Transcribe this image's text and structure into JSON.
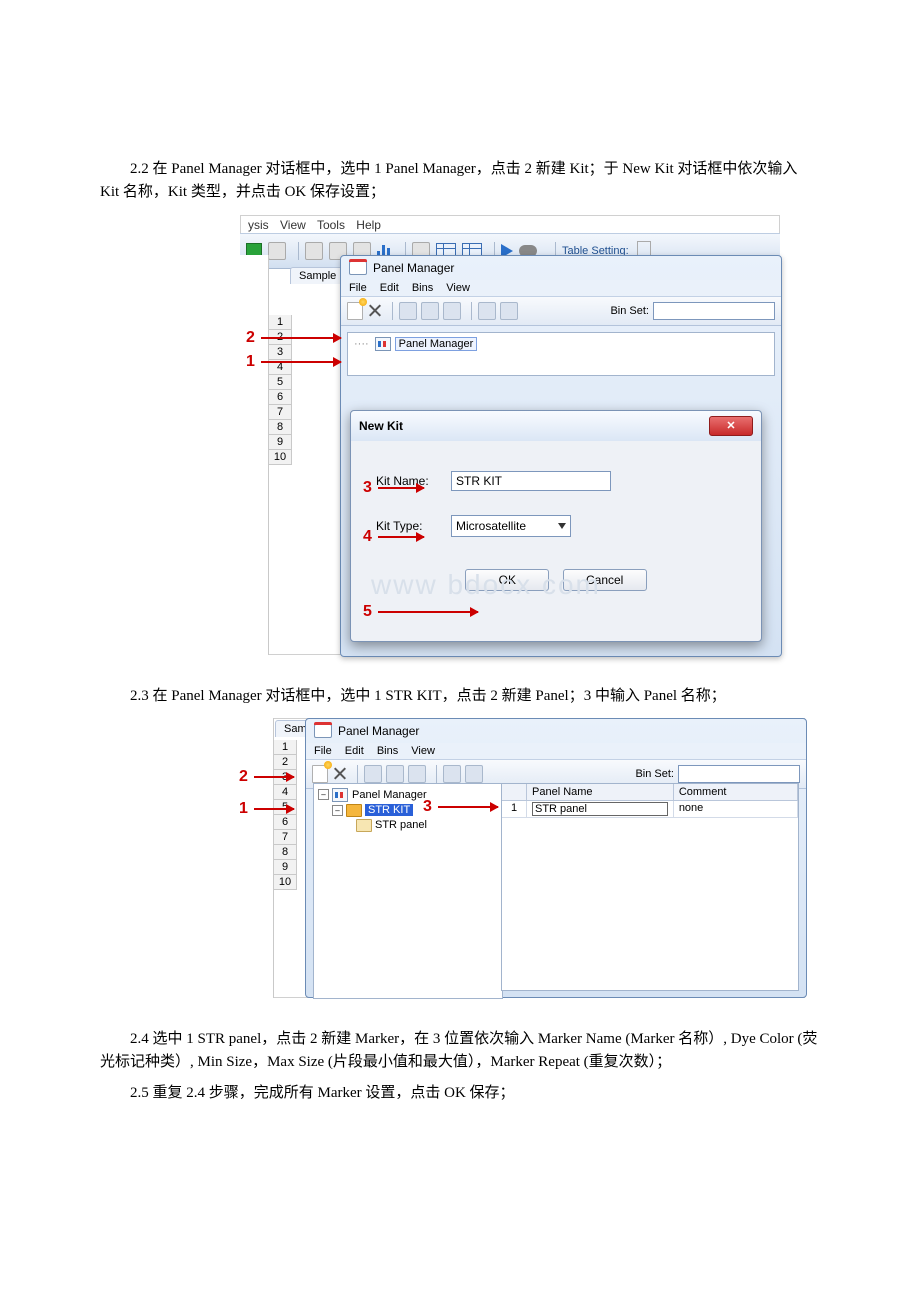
{
  "instructions": {
    "s22": "2.2 在 Panel Manager 对话框中，选中 1 Panel Manager，点击 2 新建 Kit；于 New Kit 对话框中依次输入 Kit 名称，Kit 类型，并点击 OK 保存设置；",
    "s23": "2.3 在 Panel Manager 对话框中，选中 1 STR KIT，点击 2 新建 Panel；3 中输入 Panel 名称；",
    "s24": "2.4 选中 1 STR panel，点击 2 新建 Marker，在 3 位置依次输入 Marker Name (Marker 名称）, Dye Color (荧光标记种类）, Min Size，Max Size (片段最小值和最大值），Marker Repeat (重复次数）；",
    "s25": "2.5 重复 2.4 步骤，完成所有 Marker 设置，点击 OK 保存；"
  },
  "main_menu": {
    "m1": "ysis",
    "m2": "View",
    "m3": "Tools",
    "m4": "Help"
  },
  "table_setting": "Table Setting:",
  "sample_tab": "Sample",
  "row_numbers": [
    "1",
    "2",
    "3",
    "4",
    "5",
    "6",
    "7",
    "8",
    "9",
    "10"
  ],
  "panel_manager": {
    "title": "Panel Manager",
    "menu": {
      "file": "File",
      "edit": "Edit",
      "bins": "Bins",
      "view": "View"
    },
    "binset_label": "Bin Set:",
    "tree_root": "Panel Manager"
  },
  "new_kit": {
    "title": "New Kit",
    "kit_name_label": "Kit Name:",
    "kit_name_value": "STR KIT",
    "kit_type_label": "Kit Type:",
    "kit_type_value": "Microsatellite",
    "ok": "OK",
    "cancel": "Cancel",
    "close": "✕"
  },
  "watermark": "www bdocx com",
  "callouts": {
    "c1": "1",
    "c2": "2",
    "c3": "3",
    "c4": "4",
    "c5": "5"
  },
  "fig2": {
    "tree": {
      "root": "Panel Manager",
      "kit": "STR KIT",
      "panel": "STR panel"
    },
    "grid": {
      "hdr_panel": "Panel Name",
      "hdr_comment": "Comment",
      "row1_idx": "1",
      "row1_panel": "STR panel",
      "row1_comment": "none"
    }
  }
}
